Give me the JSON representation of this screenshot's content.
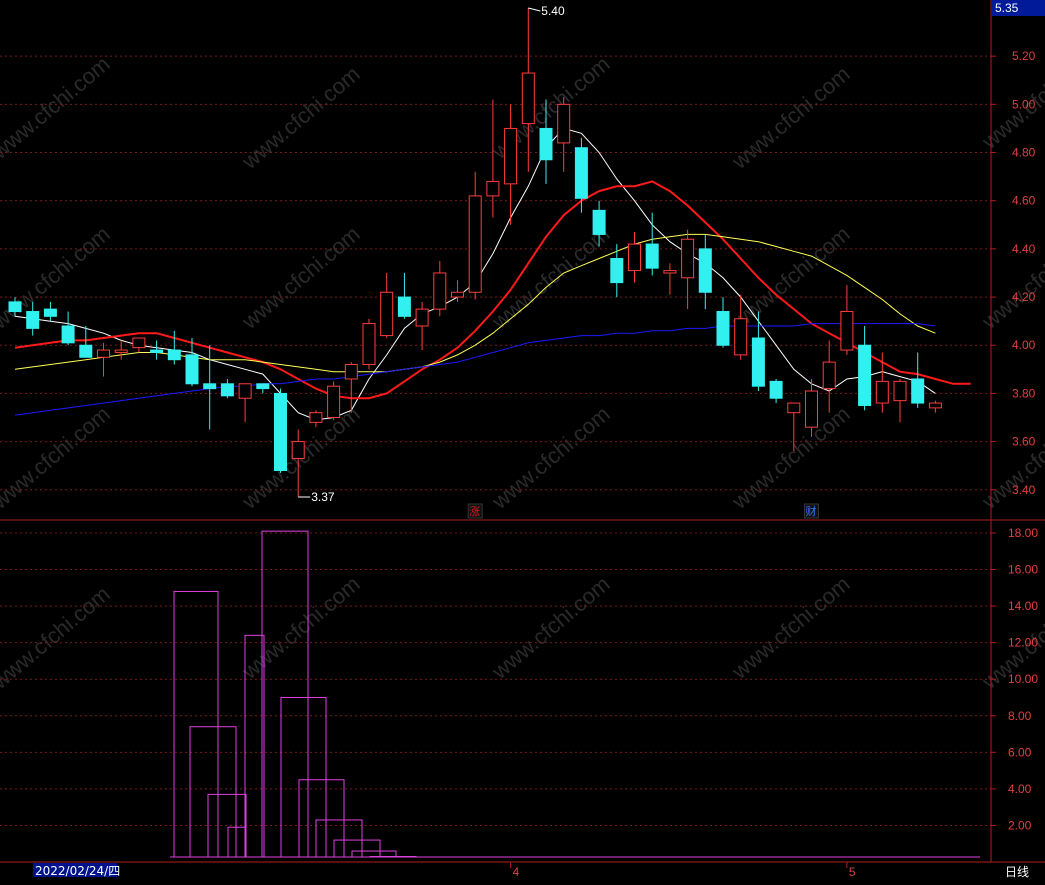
{
  "chart_data": [
    {
      "type": "candlestick",
      "ylim": [
        3.3,
        5.42
      ],
      "y_ticks": [
        "5.20",
        "5.00",
        "4.80",
        "4.60",
        "4.40",
        "4.20",
        "4.00",
        "3.80",
        "3.60",
        "3.40"
      ],
      "y_tick_values": [
        5.2,
        5.0,
        4.8,
        4.6,
        4.4,
        4.2,
        4.0,
        3.8,
        3.6,
        3.4
      ],
      "current_price": "5.35",
      "x_labels": [
        "4",
        "5"
      ],
      "x_label_index": [
        28,
        47
      ],
      "candles": [
        {
          "o": 4.18,
          "c": 4.14,
          "h": 4.2,
          "l": 4.12
        },
        {
          "o": 4.14,
          "c": 4.07,
          "h": 4.18,
          "l": 4.04
        },
        {
          "o": 4.15,
          "c": 4.12,
          "h": 4.18,
          "l": 4.1
        },
        {
          "o": 4.08,
          "c": 4.01,
          "h": 4.14,
          "l": 4.0
        },
        {
          "o": 4.0,
          "c": 3.95,
          "h": 4.08,
          "l": 3.95
        },
        {
          "o": 3.95,
          "c": 3.98,
          "h": 4.01,
          "l": 3.87
        },
        {
          "o": 3.97,
          "c": 3.98,
          "h": 4.02,
          "l": 3.94
        },
        {
          "o": 3.99,
          "c": 4.03,
          "h": 4.03,
          "l": 3.97
        },
        {
          "o": 3.98,
          "c": 3.97,
          "h": 4.02,
          "l": 3.94
        },
        {
          "o": 3.98,
          "c": 3.94,
          "h": 4.06,
          "l": 3.92
        },
        {
          "o": 3.96,
          "c": 3.84,
          "h": 4.03,
          "l": 3.83
        },
        {
          "o": 3.84,
          "c": 3.82,
          "h": 4.0,
          "l": 3.65
        },
        {
          "o": 3.84,
          "c": 3.79,
          "h": 3.86,
          "l": 3.78
        },
        {
          "o": 3.78,
          "c": 3.84,
          "h": 3.84,
          "l": 3.68
        },
        {
          "o": 3.84,
          "c": 3.82,
          "h": 3.84,
          "l": 3.8
        },
        {
          "o": 3.8,
          "c": 3.48,
          "h": 3.82,
          "l": 3.47
        },
        {
          "o": 3.53,
          "c": 3.6,
          "h": 3.65,
          "l": 3.37
        },
        {
          "o": 3.68,
          "c": 3.72,
          "h": 3.73,
          "l": 3.66
        },
        {
          "o": 3.7,
          "c": 3.83,
          "h": 3.85,
          "l": 3.69
        },
        {
          "o": 3.86,
          "c": 3.92,
          "h": 3.93,
          "l": 3.72
        },
        {
          "o": 3.92,
          "c": 4.09,
          "h": 4.11,
          "l": 3.9
        },
        {
          "o": 4.04,
          "c": 4.22,
          "h": 4.3,
          "l": 4.03
        },
        {
          "o": 4.2,
          "c": 4.12,
          "h": 4.3,
          "l": 4.11
        },
        {
          "o": 4.08,
          "c": 4.15,
          "h": 4.18,
          "l": 3.98
        },
        {
          "o": 4.15,
          "c": 4.3,
          "h": 4.35,
          "l": 4.12
        },
        {
          "o": 4.2,
          "c": 4.22,
          "h": 4.27,
          "l": 4.18
        },
        {
          "o": 4.22,
          "c": 4.62,
          "h": 4.72,
          "l": 4.19
        },
        {
          "o": 4.62,
          "c": 4.68,
          "h": 5.02,
          "l": 4.53
        },
        {
          "o": 4.67,
          "c": 4.9,
          "h": 5.0,
          "l": 4.5
        },
        {
          "o": 4.92,
          "c": 5.13,
          "h": 5.4,
          "l": 4.72
        },
        {
          "o": 4.9,
          "c": 4.77,
          "h": 5.02,
          "l": 4.67
        },
        {
          "o": 4.84,
          "c": 5.0,
          "h": 5.03,
          "l": 4.72
        },
        {
          "o": 4.82,
          "c": 4.61,
          "h": 4.86,
          "l": 4.55
        },
        {
          "o": 4.56,
          "c": 4.46,
          "h": 4.6,
          "l": 4.41
        },
        {
          "o": 4.36,
          "c": 4.26,
          "h": 4.42,
          "l": 4.2
        },
        {
          "o": 4.31,
          "c": 4.42,
          "h": 4.47,
          "l": 4.26
        },
        {
          "o": 4.42,
          "c": 4.32,
          "h": 4.55,
          "l": 4.29
        },
        {
          "o": 4.3,
          "c": 4.31,
          "h": 4.34,
          "l": 4.21
        },
        {
          "o": 4.28,
          "c": 4.44,
          "h": 4.48,
          "l": 4.15
        },
        {
          "o": 4.4,
          "c": 4.22,
          "h": 4.46,
          "l": 4.15
        },
        {
          "o": 4.14,
          "c": 4.0,
          "h": 4.2,
          "l": 3.99
        },
        {
          "o": 3.96,
          "c": 4.11,
          "h": 4.21,
          "l": 3.94
        },
        {
          "o": 4.03,
          "c": 3.83,
          "h": 4.14,
          "l": 3.81
        },
        {
          "o": 3.85,
          "c": 3.78,
          "h": 3.86,
          "l": 3.76
        },
        {
          "o": 3.72,
          "c": 3.76,
          "h": 3.76,
          "l": 3.56
        },
        {
          "o": 3.66,
          "c": 3.81,
          "h": 3.86,
          "l": 3.62
        },
        {
          "o": 3.82,
          "c": 3.93,
          "h": 4.02,
          "l": 3.72
        },
        {
          "o": 3.98,
          "c": 4.14,
          "h": 4.25,
          "l": 3.96
        },
        {
          "o": 4.0,
          "c": 3.75,
          "h": 4.08,
          "l": 3.73
        },
        {
          "o": 3.76,
          "c": 3.85,
          "h": 3.97,
          "l": 3.72
        },
        {
          "o": 3.77,
          "c": 3.85,
          "h": 3.86,
          "l": 3.68
        },
        {
          "o": 3.86,
          "c": 3.76,
          "h": 3.97,
          "l": 3.74
        },
        {
          "o": 3.74,
          "c": 3.76,
          "h": 3.77,
          "l": 3.72
        }
      ],
      "ma_lines": [
        {
          "color": "#ffffff",
          "values": [
            4.12,
            4.11,
            4.1,
            4.09,
            4.07,
            4.05,
            4.02,
            4.0,
            3.99,
            3.98,
            3.97,
            3.94,
            3.92,
            3.9,
            3.88,
            3.8,
            3.72,
            3.69,
            3.7,
            3.73,
            3.86,
            3.96,
            4.07,
            4.13,
            4.16,
            4.2,
            4.26,
            4.38,
            4.53,
            4.66,
            4.82,
            4.9,
            4.88,
            4.8,
            4.69,
            4.6,
            4.5,
            4.43,
            4.38,
            4.34,
            4.28,
            4.2,
            4.1,
            4.0,
            3.9,
            3.84,
            3.81,
            3.86,
            3.87,
            3.89,
            3.87,
            3.85,
            3.8
          ]
        },
        {
          "color": "#ff1a1a",
          "values": [
            3.99,
            4.0,
            4.01,
            4.02,
            4.02,
            4.03,
            4.04,
            4.05,
            4.05,
            4.03,
            4.01,
            3.99,
            3.97,
            3.95,
            3.93,
            3.9,
            3.86,
            3.82,
            3.79,
            3.78,
            3.78,
            3.8,
            3.85,
            3.9,
            3.94,
            3.99,
            4.06,
            4.14,
            4.23,
            4.34,
            4.45,
            4.54,
            4.6,
            4.64,
            4.66,
            4.66,
            4.68,
            4.64,
            4.58,
            4.51,
            4.44,
            4.36,
            4.28,
            4.21,
            4.15,
            4.09,
            4.05,
            4.01,
            3.97,
            3.93,
            3.89,
            3.88,
            3.86,
            3.84,
            3.84
          ]
        },
        {
          "color": "#ffff55",
          "values": [
            3.9,
            3.91,
            3.92,
            3.93,
            3.94,
            3.95,
            3.96,
            3.97,
            3.97,
            3.96,
            3.95,
            3.94,
            3.94,
            3.94,
            3.93,
            3.92,
            3.91,
            3.9,
            3.89,
            3.89,
            3.89,
            3.89,
            3.9,
            3.91,
            3.93,
            3.96,
            4.0,
            4.05,
            4.11,
            4.17,
            4.24,
            4.3,
            4.33,
            4.36,
            4.39,
            4.42,
            4.44,
            4.45,
            4.46,
            4.46,
            4.45,
            4.44,
            4.43,
            4.41,
            4.39,
            4.37,
            4.33,
            4.29,
            4.24,
            4.19,
            4.13,
            4.08,
            4.05
          ]
        },
        {
          "color": "#1a1aff",
          "values": [
            3.71,
            3.72,
            3.73,
            3.74,
            3.75,
            3.76,
            3.77,
            3.78,
            3.79,
            3.8,
            3.81,
            3.82,
            3.83,
            3.83,
            3.84,
            3.84,
            3.85,
            3.86,
            3.86,
            3.87,
            3.88,
            3.89,
            3.9,
            3.91,
            3.92,
            3.93,
            3.95,
            3.97,
            3.99,
            4.01,
            4.02,
            4.03,
            4.04,
            4.04,
            4.05,
            4.05,
            4.06,
            4.06,
            4.07,
            4.07,
            4.08,
            4.08,
            4.08,
            4.08,
            4.08,
            4.09,
            4.09,
            4.09,
            4.09,
            4.09,
            4.09,
            4.09,
            4.08
          ]
        }
      ],
      "annotations": [
        {
          "text": "5.40",
          "index": 29,
          "value": 5.4
        },
        {
          "text": "3.37",
          "index": 16,
          "value": 3.37
        }
      ],
      "markers": [
        {
          "text": "涨",
          "index": 26,
          "color": "#cc2222"
        },
        {
          "text": "财",
          "index": 45,
          "color": "#3377ff"
        }
      ]
    },
    {
      "type": "bar",
      "ylim": [
        0,
        18.6
      ],
      "y_ticks": [
        "18.00",
        "16.00",
        "14.00",
        "12.00",
        "10.00",
        "8.00",
        "6.00",
        "4.00",
        "2.00"
      ],
      "y_tick_values": [
        18,
        16,
        14,
        12,
        10,
        8,
        6,
        4,
        2
      ],
      "date_label": "2022/02/24/四",
      "period_label": "日线",
      "boxes": [
        {
          "l": 174,
          "r": 218,
          "v": 14.8
        },
        {
          "l": 190,
          "r": 236,
          "v": 7.4
        },
        {
          "l": 208,
          "r": 246,
          "v": 3.7
        },
        {
          "l": 228,
          "r": 246,
          "v": 1.9
        },
        {
          "l": 245,
          "r": 264,
          "v": 12.4
        },
        {
          "l": 262,
          "r": 308,
          "v": 18.1
        },
        {
          "l": 281,
          "r": 326,
          "v": 9.0
        },
        {
          "l": 299,
          "r": 344,
          "v": 4.5
        },
        {
          "l": 316,
          "r": 362,
          "v": 2.3
        },
        {
          "l": 334,
          "r": 380,
          "v": 1.2
        },
        {
          "l": 352,
          "r": 396,
          "v": 0.6
        },
        {
          "l": 370,
          "r": 416,
          "v": 0.3
        },
        {
          "l": 388,
          "r": 432,
          "v": 0.15
        },
        {
          "l": 405,
          "r": 455,
          "v": 0.08
        },
        {
          "l": 420,
          "r": 980,
          "v": 0.02
        }
      ]
    }
  ],
  "watermark": "www.cfchi.com",
  "bottom_bar_text": "...",
  "colors": {
    "up": "#ff3c3c",
    "down": "#33f0f0",
    "axis": "#b01e1e",
    "grid": "#7a1a1a",
    "vol": "#e040e0"
  }
}
